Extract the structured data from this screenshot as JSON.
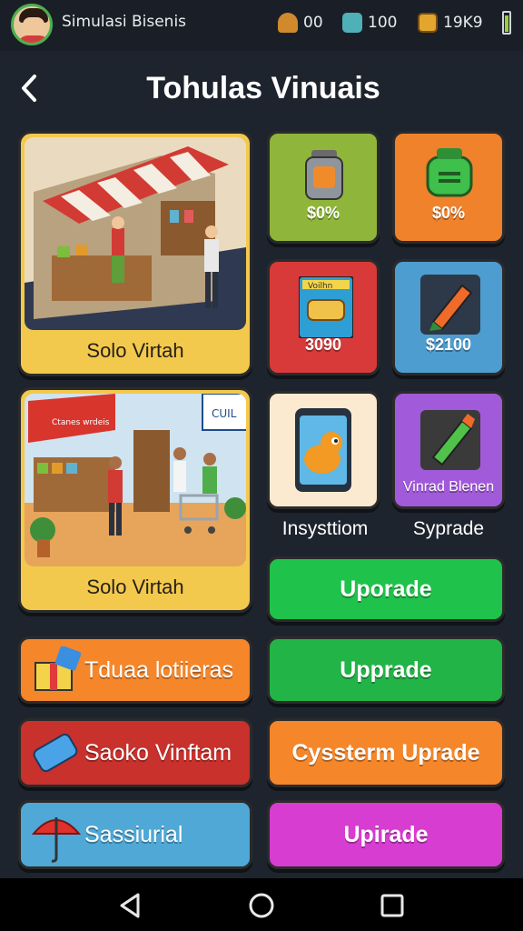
{
  "topbar": {
    "title": "Simulasi Bisenis",
    "resources": [
      {
        "name": "cone",
        "value": "00",
        "color": "#d08a2c"
      },
      {
        "name": "cash-stack",
        "value": "100",
        "color": "#4fb0b8"
      },
      {
        "name": "crate",
        "value": "19K9",
        "color": "#e2a62f"
      }
    ]
  },
  "header": {
    "title": "Tohulas Vinuais",
    "back_icon": "chevron-left-icon"
  },
  "scenes": [
    {
      "label": "Solo Virtah",
      "sign": ""
    },
    {
      "label": "Solo Virtah",
      "sign": "Ctanes wrdeis",
      "tag": "CUIL"
    }
  ],
  "tiles": [
    {
      "label": "$0%",
      "color": "#8fb63a",
      "icon": "jar-icon"
    },
    {
      "label": "$0%",
      "color": "#f0822b",
      "icon": "green-container-icon"
    },
    {
      "label": "3090",
      "color": "#d83a3a",
      "icon": "poster-icon",
      "poster_text": "Voilhn"
    },
    {
      "label": "$2100",
      "color": "#4e9dd0",
      "icon": "marker-icon"
    },
    {
      "label": "",
      "color": "#fbead0",
      "icon": "phone-app-icon"
    },
    {
      "label": "Vinrad Blenen",
      "color": "#a15ad9",
      "icon": "green-marker-icon"
    }
  ],
  "captions": [
    "Insysttiom",
    "Syprade"
  ],
  "right_buttons": [
    {
      "label": "Uporade",
      "color": "#1fc24a"
    },
    {
      "label": "Upprade",
      "color": "#22b446"
    },
    {
      "label": "Cyssterm Uprade",
      "color": "#f5862a"
    },
    {
      "label": "Upirade",
      "color": "#d63dd0"
    }
  ],
  "left_buttons": [
    {
      "label": "Tduaa lotiieras",
      "color": "#f5862a",
      "icon": "gift-box-icon"
    },
    {
      "label": "Saoko Vinftam",
      "color": "#c8312c",
      "icon": "ticket-icon"
    },
    {
      "label": "Sassiurial",
      "color": "#4fa8d6",
      "icon": "umbrella-icon"
    }
  ]
}
